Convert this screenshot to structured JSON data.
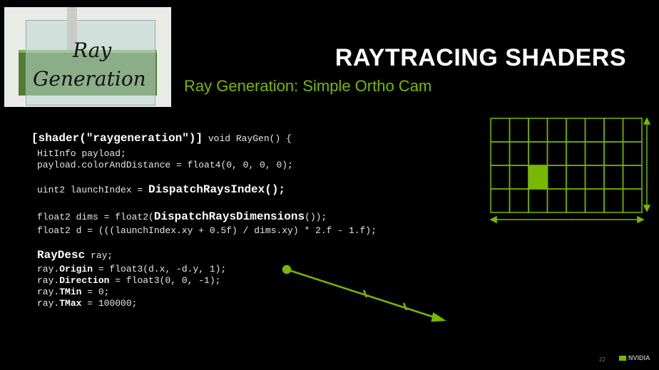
{
  "slide": {
    "title": "RAYTRACING SHADERS",
    "subtitle": "Ray Generation: Simple Ortho Cam",
    "thumbnail": {
      "word1": "Ray",
      "word2": "Generation"
    },
    "page_number": "22",
    "logo_text": "NVIDIA"
  },
  "code": {
    "l0a": "[shader(\"raygeneration\")]",
    "l0b": " void RayGen() {",
    "l1": "HitInfo payload;",
    "l2": "payload.colorAndDistance = float4(0, 0, 0, 0);",
    "l3a": "uint2 launchIndex = ",
    "l3b": "DispatchRaysIndex",
    "l3c": "();",
    "l4a": "float2 dims = float2(",
    "l4b": "DispatchRaysDimensions",
    "l4c": "());",
    "l5": "float2 d = (((launchIndex.xy + 0.5f) / dims.xy) * 2.f - 1.f);",
    "l6a": "RayDesc",
    "l6b": " ray;",
    "l7a": "ray.",
    "l7b": "Origin",
    "l7c": " = float3(d.x, -d.y, 1);",
    "l8a": "ray.",
    "l8b": "Direction",
    "l8c": " = float3(0, 0, -1);",
    "l9a": "ray.",
    "l9b": "TMin",
    "l9c": " = 0;",
    "l10a": "ray.",
    "l10b": "TMax",
    "l10c": " = 100000;"
  },
  "grid": {
    "cols": 8,
    "rows": 4,
    "highlight_col": 2,
    "highlight_row": 2,
    "color": "#76b900"
  },
  "colors": {
    "accent": "#76b900",
    "background": "#000000",
    "title": "#ffffff"
  }
}
